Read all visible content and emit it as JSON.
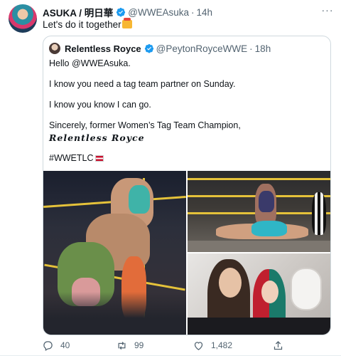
{
  "tweet": {
    "author_name": "ASUKA / 明日華",
    "author_handle": "@WWEAsuka",
    "separator": "·",
    "time": "14h",
    "text": "Let's do it together",
    "more_icon": "more-icon"
  },
  "quoted": {
    "author_name": "Relentless Royce",
    "author_handle": "@PeytonRoyceWWE",
    "separator": "·",
    "time": "18h",
    "lines": [
      "Hello @WWEAsuka.",
      "I know you need a tag team partner on Sunday.",
      "I know you know I can go.",
      "Sincerely, former Women’s Tag Team Champion,",
      "Relentless Royce",
      "#WWETLC"
    ]
  },
  "media": {
    "images": [
      "wrestling-ring-photo",
      "wrestling-pin-photo",
      "airplane-selfie-photo"
    ]
  },
  "actions": {
    "replies": "40",
    "retweets": "99",
    "likes": "1,482"
  },
  "colors": {
    "verified": "#1d9bf0",
    "muted": "#536471",
    "border": "#cfd9de"
  }
}
